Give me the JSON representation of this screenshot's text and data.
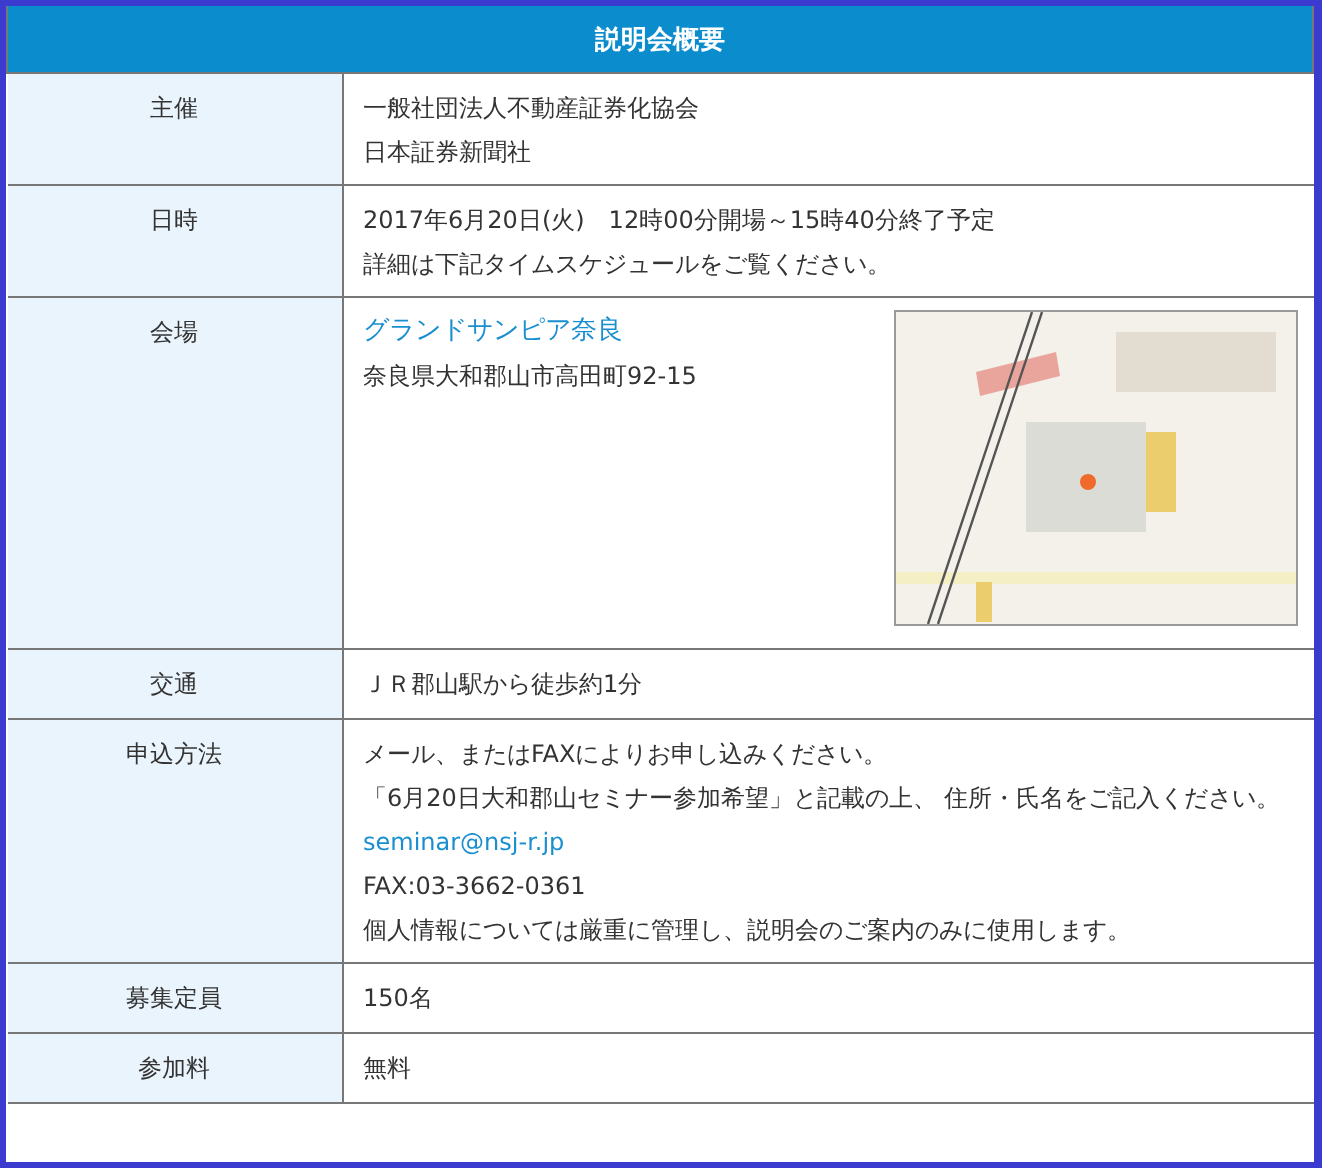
{
  "title": "説明会概要",
  "rows": [
    {
      "label": "主催",
      "lines": [
        {
          "kind": "text",
          "text": "一般社団法人不動産証券化協会"
        },
        {
          "kind": "text",
          "text": "日本証券新聞社"
        }
      ]
    },
    {
      "label": "日時",
      "lines": [
        {
          "kind": "text",
          "text": "2017年6月20日(火)　12時00分開場～15時40分終了予定"
        },
        {
          "kind": "text",
          "text": "詳細は下記タイムスケジュールをご覧ください。"
        }
      ]
    },
    {
      "label": "会場",
      "has_map": true,
      "lines": [
        {
          "kind": "link",
          "text": "グランドサンピア奈良"
        },
        {
          "kind": "text",
          "text": "奈良県大和郡山市高田町92-15"
        }
      ]
    },
    {
      "label": "交通",
      "lines": [
        {
          "kind": "text",
          "text": "ＪＲ郡山駅から徒歩約1分"
        }
      ]
    },
    {
      "label": "申込方法",
      "lines": [
        {
          "kind": "text",
          "text": "メール、またはFAXによりお申し込みください。"
        },
        {
          "kind": "text",
          "text": "「6月20日大和郡山セミナー参加希望」と記載の上、 住所・氏名をご記入ください。"
        },
        {
          "kind": "link",
          "text": "seminar@nsj-r.jp"
        },
        {
          "kind": "text",
          "text": "FAX:03-3662-0361"
        },
        {
          "kind": "text",
          "text": "個人情報については厳重に管理し、説明会のご案内のみに使用します。"
        }
      ]
    },
    {
      "label": "募集定員",
      "lines": [
        {
          "kind": "text",
          "text": "150名"
        }
      ]
    },
    {
      "label": "参加料",
      "lines": [
        {
          "kind": "text",
          "text": "無料"
        }
      ]
    }
  ]
}
